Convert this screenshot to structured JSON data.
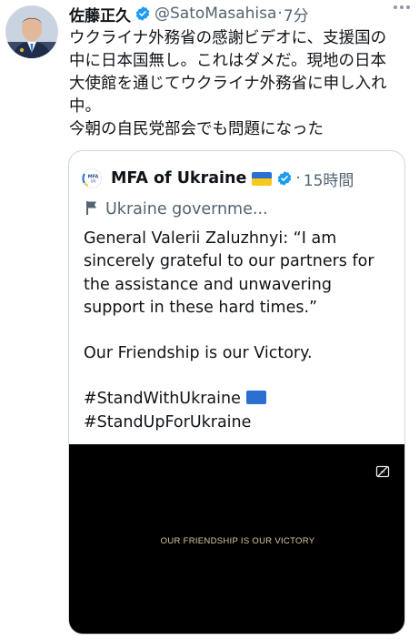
{
  "tweet": {
    "display_name": "佐藤正久",
    "handle": "@SatoMasahisa",
    "separator": "·",
    "time": "7分",
    "text_lines": [
      "ウクライナ外務省の感謝ビデオに、支援国の",
      "中に日本国無し。これはダメだ。現地の日本",
      "大使館を通じてウクライナ外務省に申し入れ",
      "中。",
      "今朝の自民党部会でも問題になった"
    ]
  },
  "quote": {
    "name": "MFA of Ukraine",
    "separator": "·",
    "time": "15時間",
    "context_label": "Ukraine governme...",
    "body_lines": [
      "General Valerii Zaluzhnyi: “I am",
      "sincerely grateful to our partners for",
      "the assistance and unwavering",
      "support in these hard times.”",
      "",
      "Our Friendship is our Victory.",
      "",
      "#StandWithUkraine",
      "#StandUpForUkraine"
    ],
    "logo_text_top": "MFA",
    "logo_text_bottom": "UA",
    "video_caption": "OUR FRIENDSHIP IS OUR VICTORY"
  },
  "colors": {
    "verified": "#1d9bf0",
    "secondary_text": "#536471",
    "flag_blue": "#2a6fd1",
    "flag_yellow": "#f6c91a"
  },
  "icons": {
    "verified": "verified-badge-icon",
    "flag_context": "flag-icon",
    "captions": "captions-icon",
    "more": "more-icon"
  }
}
